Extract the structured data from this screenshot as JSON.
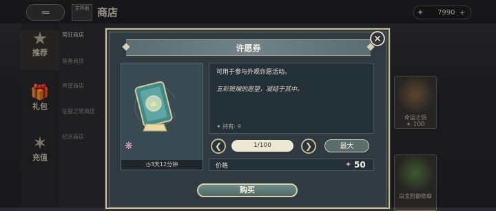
{
  "header": {
    "back_icon": "back-arrow-icon",
    "home_label": "主界面",
    "title": "商店",
    "currency_amount": "7990",
    "currency_plus": "+"
  },
  "sidebar": {
    "items": [
      {
        "label": "推荐",
        "icon": "star-icon"
      },
      {
        "label": "礼包",
        "icon": "gift-icon"
      },
      {
        "label": "充值",
        "icon": "starburst-icon"
      }
    ]
  },
  "sub_nav": {
    "items": [
      {
        "label": "常驻商店"
      },
      {
        "label": "装备商店"
      },
      {
        "label": "声望商店"
      },
      {
        "label": "征服之塔商店"
      },
      {
        "label": "纪念商店"
      }
    ]
  },
  "right_panel": {
    "cards": [
      {
        "name": "命运之钥",
        "price": "100"
      },
      {
        "name": "白金防御勋章",
        "price": ""
      }
    ]
  },
  "modal": {
    "title": "许愿券",
    "description": "可用于参与外观许愿活动。",
    "flavor": "五彩斑斓的愿望，凝结于其中。",
    "owned": "持有: 9",
    "timer": "3天12分钟",
    "quantity": "1/100",
    "max_label": "最大",
    "price_label": "价格",
    "price_value": "50",
    "buy_label": "购买",
    "close_icon": "close-icon"
  },
  "colors": {
    "accent_gold": "#c8bc9a",
    "gem_pink": "#e7a6c4",
    "modal_bg": "#2f3a41"
  }
}
